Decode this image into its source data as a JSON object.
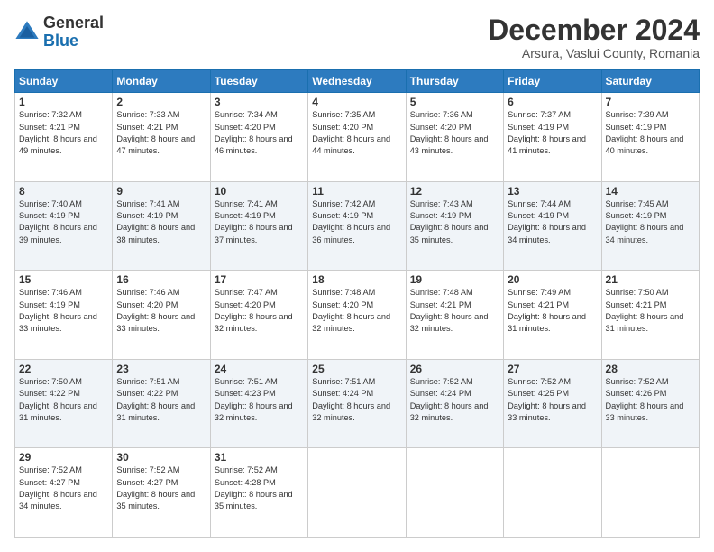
{
  "logo": {
    "line1": "General",
    "line2": "Blue"
  },
  "header": {
    "month": "December 2024",
    "location": "Arsura, Vaslui County, Romania"
  },
  "weekdays": [
    "Sunday",
    "Monday",
    "Tuesday",
    "Wednesday",
    "Thursday",
    "Friday",
    "Saturday"
  ],
  "weeks": [
    [
      {
        "day": 1,
        "sunrise": "7:32 AM",
        "sunset": "4:21 PM",
        "daylight": "8 hours and 49 minutes."
      },
      {
        "day": 2,
        "sunrise": "7:33 AM",
        "sunset": "4:21 PM",
        "daylight": "8 hours and 47 minutes."
      },
      {
        "day": 3,
        "sunrise": "7:34 AM",
        "sunset": "4:20 PM",
        "daylight": "8 hours and 46 minutes."
      },
      {
        "day": 4,
        "sunrise": "7:35 AM",
        "sunset": "4:20 PM",
        "daylight": "8 hours and 44 minutes."
      },
      {
        "day": 5,
        "sunrise": "7:36 AM",
        "sunset": "4:20 PM",
        "daylight": "8 hours and 43 minutes."
      },
      {
        "day": 6,
        "sunrise": "7:37 AM",
        "sunset": "4:19 PM",
        "daylight": "8 hours and 41 minutes."
      },
      {
        "day": 7,
        "sunrise": "7:39 AM",
        "sunset": "4:19 PM",
        "daylight": "8 hours and 40 minutes."
      }
    ],
    [
      {
        "day": 8,
        "sunrise": "7:40 AM",
        "sunset": "4:19 PM",
        "daylight": "8 hours and 39 minutes."
      },
      {
        "day": 9,
        "sunrise": "7:41 AM",
        "sunset": "4:19 PM",
        "daylight": "8 hours and 38 minutes."
      },
      {
        "day": 10,
        "sunrise": "7:41 AM",
        "sunset": "4:19 PM",
        "daylight": "8 hours and 37 minutes."
      },
      {
        "day": 11,
        "sunrise": "7:42 AM",
        "sunset": "4:19 PM",
        "daylight": "8 hours and 36 minutes."
      },
      {
        "day": 12,
        "sunrise": "7:43 AM",
        "sunset": "4:19 PM",
        "daylight": "8 hours and 35 minutes."
      },
      {
        "day": 13,
        "sunrise": "7:44 AM",
        "sunset": "4:19 PM",
        "daylight": "8 hours and 34 minutes."
      },
      {
        "day": 14,
        "sunrise": "7:45 AM",
        "sunset": "4:19 PM",
        "daylight": "8 hours and 34 minutes."
      }
    ],
    [
      {
        "day": 15,
        "sunrise": "7:46 AM",
        "sunset": "4:19 PM",
        "daylight": "8 hours and 33 minutes."
      },
      {
        "day": 16,
        "sunrise": "7:46 AM",
        "sunset": "4:20 PM",
        "daylight": "8 hours and 33 minutes."
      },
      {
        "day": 17,
        "sunrise": "7:47 AM",
        "sunset": "4:20 PM",
        "daylight": "8 hours and 32 minutes."
      },
      {
        "day": 18,
        "sunrise": "7:48 AM",
        "sunset": "4:20 PM",
        "daylight": "8 hours and 32 minutes."
      },
      {
        "day": 19,
        "sunrise": "7:48 AM",
        "sunset": "4:21 PM",
        "daylight": "8 hours and 32 minutes."
      },
      {
        "day": 20,
        "sunrise": "7:49 AM",
        "sunset": "4:21 PM",
        "daylight": "8 hours and 31 minutes."
      },
      {
        "day": 21,
        "sunrise": "7:50 AM",
        "sunset": "4:21 PM",
        "daylight": "8 hours and 31 minutes."
      }
    ],
    [
      {
        "day": 22,
        "sunrise": "7:50 AM",
        "sunset": "4:22 PM",
        "daylight": "8 hours and 31 minutes."
      },
      {
        "day": 23,
        "sunrise": "7:51 AM",
        "sunset": "4:22 PM",
        "daylight": "8 hours and 31 minutes."
      },
      {
        "day": 24,
        "sunrise": "7:51 AM",
        "sunset": "4:23 PM",
        "daylight": "8 hours and 32 minutes."
      },
      {
        "day": 25,
        "sunrise": "7:51 AM",
        "sunset": "4:24 PM",
        "daylight": "8 hours and 32 minutes."
      },
      {
        "day": 26,
        "sunrise": "7:52 AM",
        "sunset": "4:24 PM",
        "daylight": "8 hours and 32 minutes."
      },
      {
        "day": 27,
        "sunrise": "7:52 AM",
        "sunset": "4:25 PM",
        "daylight": "8 hours and 33 minutes."
      },
      {
        "day": 28,
        "sunrise": "7:52 AM",
        "sunset": "4:26 PM",
        "daylight": "8 hours and 33 minutes."
      }
    ],
    [
      {
        "day": 29,
        "sunrise": "7:52 AM",
        "sunset": "4:27 PM",
        "daylight": "8 hours and 34 minutes."
      },
      {
        "day": 30,
        "sunrise": "7:52 AM",
        "sunset": "4:27 PM",
        "daylight": "8 hours and 35 minutes."
      },
      {
        "day": 31,
        "sunrise": "7:52 AM",
        "sunset": "4:28 PM",
        "daylight": "8 hours and 35 minutes."
      },
      null,
      null,
      null,
      null
    ]
  ]
}
